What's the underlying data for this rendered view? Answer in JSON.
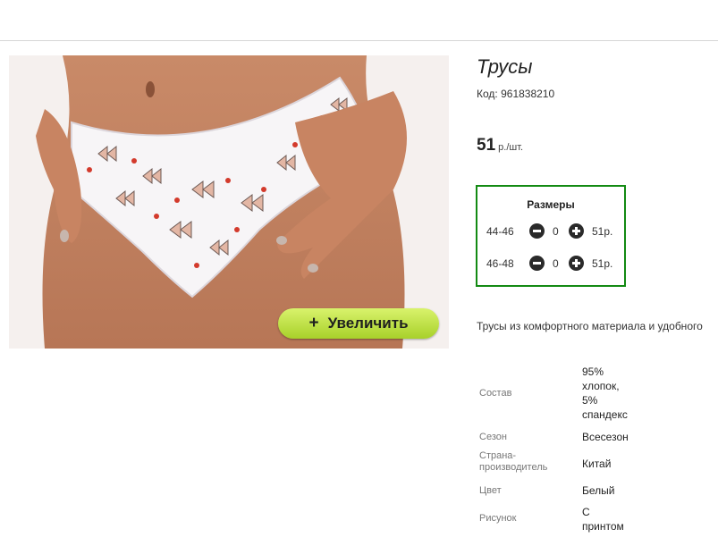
{
  "product": {
    "title": "Трусы",
    "code_label": "Код:",
    "code": "961838210",
    "price_value": "51",
    "price_unit": "р./шт.",
    "zoom_plus": "+",
    "zoom_label": "Увеличить",
    "description": "Трусы из комфортного материала и удобного"
  },
  "sizes": {
    "title": "Размеры",
    "rows": [
      {
        "size": "44-46",
        "qty": "0",
        "price": "51р."
      },
      {
        "size": "46-48",
        "qty": "0",
        "price": "51р."
      }
    ]
  },
  "specs": [
    {
      "key_lines": [
        "Состав"
      ],
      "value_lines": [
        "95%",
        "хлопок,",
        "5%",
        "спандекс"
      ]
    },
    {
      "key_lines": [
        "Сезон"
      ],
      "value_lines": [
        "Всесезон"
      ]
    },
    {
      "key_lines": [
        "Страна-",
        "производитель"
      ],
      "value_lines": [
        "Китай"
      ]
    },
    {
      "key_lines": [
        "Цвет"
      ],
      "value_lines": [
        "Белый"
      ]
    },
    {
      "key_lines": [
        "Рисунок"
      ],
      "value_lines": [
        "С",
        "принтом"
      ]
    }
  ],
  "colors": {
    "sizes_border": "#138a13",
    "zoom_button": "#b5dc35",
    "divider": "#d6d6d6"
  },
  "icons": {
    "minus": "minus-circle-icon",
    "plus": "plus-circle-icon"
  }
}
